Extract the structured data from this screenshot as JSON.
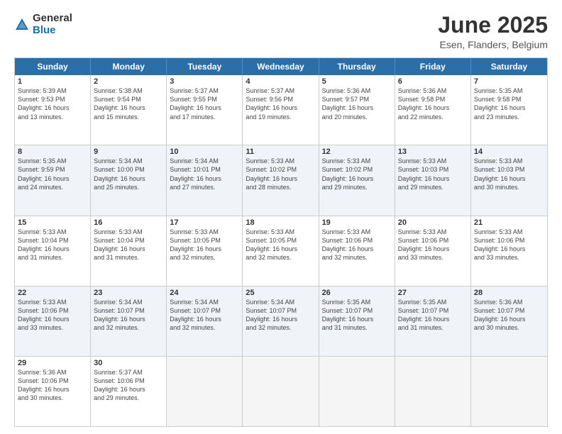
{
  "logo": {
    "general": "General",
    "blue": "Blue"
  },
  "header": {
    "month": "June 2025",
    "location": "Esen, Flanders, Belgium"
  },
  "days_of_week": [
    "Sunday",
    "Monday",
    "Tuesday",
    "Wednesday",
    "Thursday",
    "Friday",
    "Saturday"
  ],
  "weeks": [
    [
      {
        "day": "1",
        "info": "Sunrise: 5:39 AM\nSunset: 9:53 PM\nDaylight: 16 hours\nand 13 minutes."
      },
      {
        "day": "2",
        "info": "Sunrise: 5:38 AM\nSunset: 9:54 PM\nDaylight: 16 hours\nand 15 minutes."
      },
      {
        "day": "3",
        "info": "Sunrise: 5:37 AM\nSunset: 9:55 PM\nDaylight: 16 hours\nand 17 minutes."
      },
      {
        "day": "4",
        "info": "Sunrise: 5:37 AM\nSunset: 9:56 PM\nDaylight: 16 hours\nand 19 minutes."
      },
      {
        "day": "5",
        "info": "Sunrise: 5:36 AM\nSunset: 9:57 PM\nDaylight: 16 hours\nand 20 minutes."
      },
      {
        "day": "6",
        "info": "Sunrise: 5:36 AM\nSunset: 9:58 PM\nDaylight: 16 hours\nand 22 minutes."
      },
      {
        "day": "7",
        "info": "Sunrise: 5:35 AM\nSunset: 9:58 PM\nDaylight: 16 hours\nand 23 minutes."
      }
    ],
    [
      {
        "day": "8",
        "info": "Sunrise: 5:35 AM\nSunset: 9:59 PM\nDaylight: 16 hours\nand 24 minutes."
      },
      {
        "day": "9",
        "info": "Sunrise: 5:34 AM\nSunset: 10:00 PM\nDaylight: 16 hours\nand 25 minutes."
      },
      {
        "day": "10",
        "info": "Sunrise: 5:34 AM\nSunset: 10:01 PM\nDaylight: 16 hours\nand 27 minutes."
      },
      {
        "day": "11",
        "info": "Sunrise: 5:33 AM\nSunset: 10:02 PM\nDaylight: 16 hours\nand 28 minutes."
      },
      {
        "day": "12",
        "info": "Sunrise: 5:33 AM\nSunset: 10:02 PM\nDaylight: 16 hours\nand 29 minutes."
      },
      {
        "day": "13",
        "info": "Sunrise: 5:33 AM\nSunset: 10:03 PM\nDaylight: 16 hours\nand 29 minutes."
      },
      {
        "day": "14",
        "info": "Sunrise: 5:33 AM\nSunset: 10:03 PM\nDaylight: 16 hours\nand 30 minutes."
      }
    ],
    [
      {
        "day": "15",
        "info": "Sunrise: 5:33 AM\nSunset: 10:04 PM\nDaylight: 16 hours\nand 31 minutes."
      },
      {
        "day": "16",
        "info": "Sunrise: 5:33 AM\nSunset: 10:04 PM\nDaylight: 16 hours\nand 31 minutes."
      },
      {
        "day": "17",
        "info": "Sunrise: 5:33 AM\nSunset: 10:05 PM\nDaylight: 16 hours\nand 32 minutes."
      },
      {
        "day": "18",
        "info": "Sunrise: 5:33 AM\nSunset: 10:05 PM\nDaylight: 16 hours\nand 32 minutes."
      },
      {
        "day": "19",
        "info": "Sunrise: 5:33 AM\nSunset: 10:06 PM\nDaylight: 16 hours\nand 32 minutes."
      },
      {
        "day": "20",
        "info": "Sunrise: 5:33 AM\nSunset: 10:06 PM\nDaylight: 16 hours\nand 33 minutes."
      },
      {
        "day": "21",
        "info": "Sunrise: 5:33 AM\nSunset: 10:06 PM\nDaylight: 16 hours\nand 33 minutes."
      }
    ],
    [
      {
        "day": "22",
        "info": "Sunrise: 5:33 AM\nSunset: 10:06 PM\nDaylight: 16 hours\nand 33 minutes."
      },
      {
        "day": "23",
        "info": "Sunrise: 5:34 AM\nSunset: 10:07 PM\nDaylight: 16 hours\nand 32 minutes."
      },
      {
        "day": "24",
        "info": "Sunrise: 5:34 AM\nSunset: 10:07 PM\nDaylight: 16 hours\nand 32 minutes."
      },
      {
        "day": "25",
        "info": "Sunrise: 5:34 AM\nSunset: 10:07 PM\nDaylight: 16 hours\nand 32 minutes."
      },
      {
        "day": "26",
        "info": "Sunrise: 5:35 AM\nSunset: 10:07 PM\nDaylight: 16 hours\nand 31 minutes."
      },
      {
        "day": "27",
        "info": "Sunrise: 5:35 AM\nSunset: 10:07 PM\nDaylight: 16 hours\nand 31 minutes."
      },
      {
        "day": "28",
        "info": "Sunrise: 5:36 AM\nSunset: 10:07 PM\nDaylight: 16 hours\nand 30 minutes."
      }
    ],
    [
      {
        "day": "29",
        "info": "Sunrise: 5:36 AM\nSunset: 10:06 PM\nDaylight: 16 hours\nand 30 minutes."
      },
      {
        "day": "30",
        "info": "Sunrise: 5:37 AM\nSunset: 10:06 PM\nDaylight: 16 hours\nand 29 minutes."
      },
      {
        "day": "",
        "info": ""
      },
      {
        "day": "",
        "info": ""
      },
      {
        "day": "",
        "info": ""
      },
      {
        "day": "",
        "info": ""
      },
      {
        "day": "",
        "info": ""
      }
    ]
  ]
}
